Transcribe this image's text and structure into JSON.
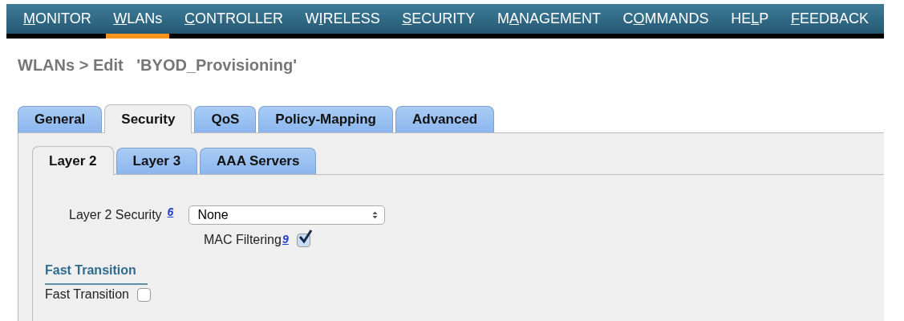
{
  "menu": [
    {
      "key": "M",
      "post": "ONITOR",
      "selected": false
    },
    {
      "key": "W",
      "post": "LANs",
      "selected": true
    },
    {
      "key": "C",
      "post": "ONTROLLER",
      "selected": false
    },
    {
      "pre": "W",
      "key": "I",
      "post": "RELESS",
      "selected": false
    },
    {
      "key": "S",
      "post": "ECURITY",
      "selected": false
    },
    {
      "pre": "M",
      "key": "A",
      "post": "NAGEMENT",
      "selected": false
    },
    {
      "pre": "C",
      "key": "O",
      "post": "MMANDS",
      "selected": false
    },
    {
      "pre": "HE",
      "key": "L",
      "post": "P",
      "selected": false
    },
    {
      "key": "F",
      "post": "EEDBACK",
      "selected": false
    }
  ],
  "breadcrumb": "WLANs > Edit   'BYOD_Provisioning'",
  "tabs": [
    {
      "label": "General",
      "selected": false
    },
    {
      "label": "Security",
      "selected": true
    },
    {
      "label": "QoS",
      "selected": false
    },
    {
      "label": "Policy-Mapping",
      "selected": false
    },
    {
      "label": "Advanced",
      "selected": false
    }
  ],
  "subtabs": [
    {
      "label": "Layer 2",
      "selected": true
    },
    {
      "label": "Layer 3",
      "selected": false
    },
    {
      "label": "AAA Servers",
      "selected": false
    }
  ],
  "layer2_security": {
    "label": "Layer 2 Security",
    "note": "6",
    "value": "None"
  },
  "mac_filtering": {
    "label": "MAC Filtering",
    "note": "9",
    "checked": true
  },
  "fast_transition": {
    "heading": "Fast Transition",
    "label": "Fast Transition",
    "checked": false
  }
}
